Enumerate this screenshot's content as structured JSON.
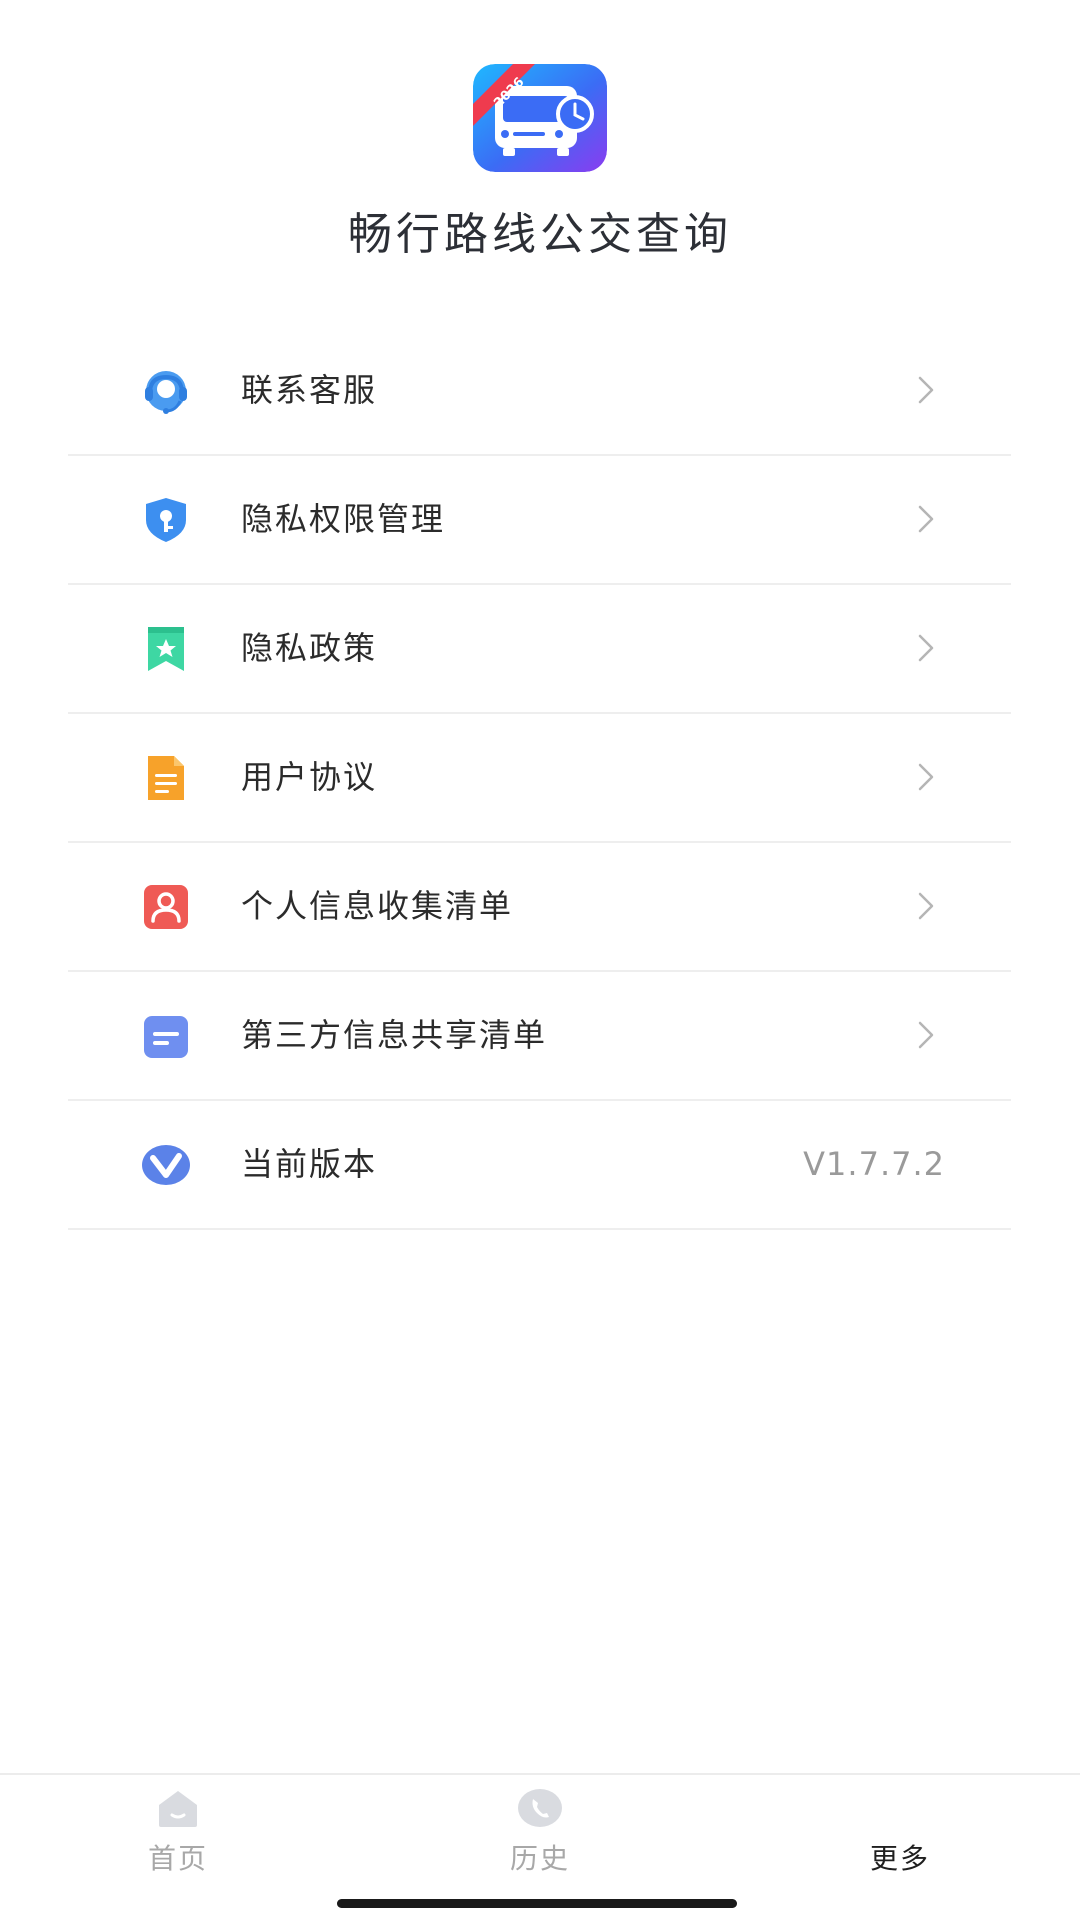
{
  "header": {
    "app_title": "畅行路线公交查询",
    "logo_badge": "2026"
  },
  "menu": {
    "items": [
      {
        "label": "联系客服",
        "icon": "headset-icon"
      },
      {
        "label": "隐私权限管理",
        "icon": "shield-key-icon"
      },
      {
        "label": "隐私政策",
        "icon": "bookmark-star-icon"
      },
      {
        "label": "用户协议",
        "icon": "document-icon"
      },
      {
        "label": "个人信息收集清单",
        "icon": "user-card-icon"
      },
      {
        "label": "第三方信息共享清单",
        "icon": "message-card-icon"
      },
      {
        "label": "当前版本",
        "icon": "version-icon",
        "value": "V1.7.7.2"
      }
    ]
  },
  "tabbar": {
    "tabs": [
      {
        "label": "首页",
        "icon": "home-icon",
        "active": false
      },
      {
        "label": "历史",
        "icon": "history-phone-icon",
        "active": false
      },
      {
        "label": "更多",
        "icon": "more-icon",
        "active": true
      }
    ]
  },
  "colors": {
    "headset": "#4a9bf0",
    "shield": "#3d8ff0",
    "bookmark": "#3ed7a3",
    "document": "#f7a22a",
    "user_card": "#ef5a55",
    "message_card": "#6f8ff0",
    "version": "#5b82e8",
    "inactive_tab": "#a8a8a8",
    "active_tab": "#1f1f1f"
  }
}
